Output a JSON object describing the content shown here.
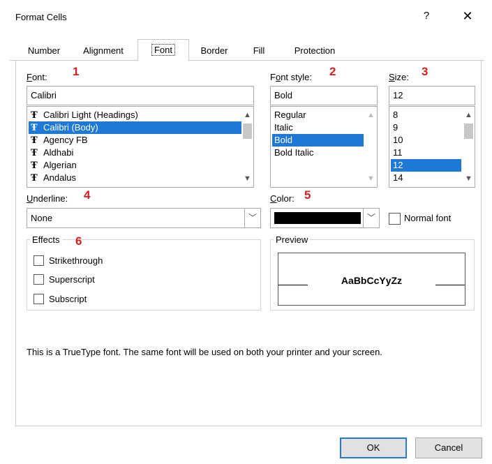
{
  "window": {
    "title": "Format Cells",
    "help_label": "?",
    "close_label": "✕"
  },
  "tabs": [
    {
      "label": "Number"
    },
    {
      "label": "Alignment"
    },
    {
      "label": "Font",
      "active": true
    },
    {
      "label": "Border"
    },
    {
      "label": "Fill"
    },
    {
      "label": "Protection"
    }
  ],
  "annotations": [
    "1",
    "2",
    "3",
    "4",
    "5",
    "6"
  ],
  "font": {
    "label": "Font:",
    "value": "Calibri",
    "items": [
      "Calibri Light (Headings)",
      "Calibri (Body)",
      "Agency FB",
      "Aldhabi",
      "Algerian",
      "Andalus"
    ],
    "selected_index": 1
  },
  "font_style": {
    "label": "Font style:",
    "value": "Bold",
    "items": [
      "Regular",
      "Italic",
      "Bold",
      "Bold Italic"
    ],
    "selected_index": 2
  },
  "size": {
    "label": "Size:",
    "value": "12",
    "items": [
      "8",
      "9",
      "10",
      "11",
      "12",
      "14"
    ],
    "selected_index": 4
  },
  "underline": {
    "label": "Underline:",
    "value": "None"
  },
  "color": {
    "label": "Color:",
    "swatch": "#000000"
  },
  "normal_font": {
    "label": "Normal font",
    "checked": false
  },
  "effects": {
    "label": "Effects",
    "items": [
      {
        "label": "Strikethrough",
        "checked": false
      },
      {
        "label": "Superscript",
        "checked": false
      },
      {
        "label": "Subscript",
        "checked": false
      }
    ]
  },
  "preview": {
    "label": "Preview",
    "sample": "AaBbCcYyZz"
  },
  "info_text": "This is a TrueType font.  The same font will be used on both your printer and your screen.",
  "buttons": {
    "ok": "OK",
    "cancel": "Cancel"
  },
  "colors": {
    "selection": "#1e78d6",
    "annotation": "#d42020",
    "primary_border": "#2a78d6"
  }
}
